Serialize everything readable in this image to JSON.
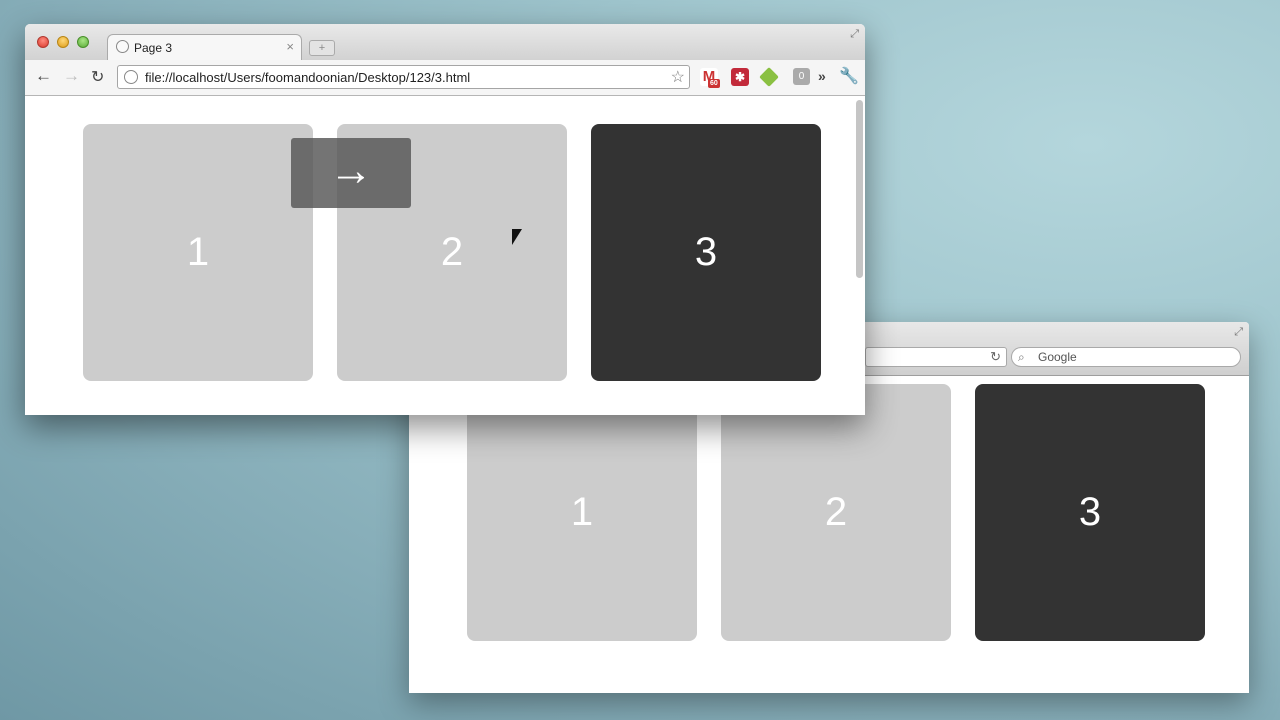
{
  "front_window": {
    "tab_title": "Page 3",
    "tab_close": "×",
    "new_tab": "+",
    "url": "file://localhost/Users/foomandoonian/Desktop/123/3.html",
    "bookmark_star": "☆",
    "back": "←",
    "forward": "→",
    "reload": "↻",
    "extensions": {
      "gmail_letter": "M",
      "gmail_badge": "60",
      "delicious": "✱",
      "grey_badge": "0",
      "overflow": "»",
      "wrench": "🔧"
    },
    "cards": [
      {
        "label": "1",
        "active": false
      },
      {
        "label": "2",
        "active": false
      },
      {
        "label": "3",
        "active": true
      }
    ],
    "arrow_overlay": "→"
  },
  "back_window": {
    "search_placeholder": "Google",
    "reload": "↻",
    "cards": [
      {
        "label": "1",
        "active": false
      },
      {
        "label": "2",
        "active": false
      },
      {
        "label": "3",
        "active": true
      }
    ]
  },
  "colors": {
    "card_inactive": "#cccccc",
    "card_active": "#333333",
    "desktop": "#8fb6bf"
  }
}
